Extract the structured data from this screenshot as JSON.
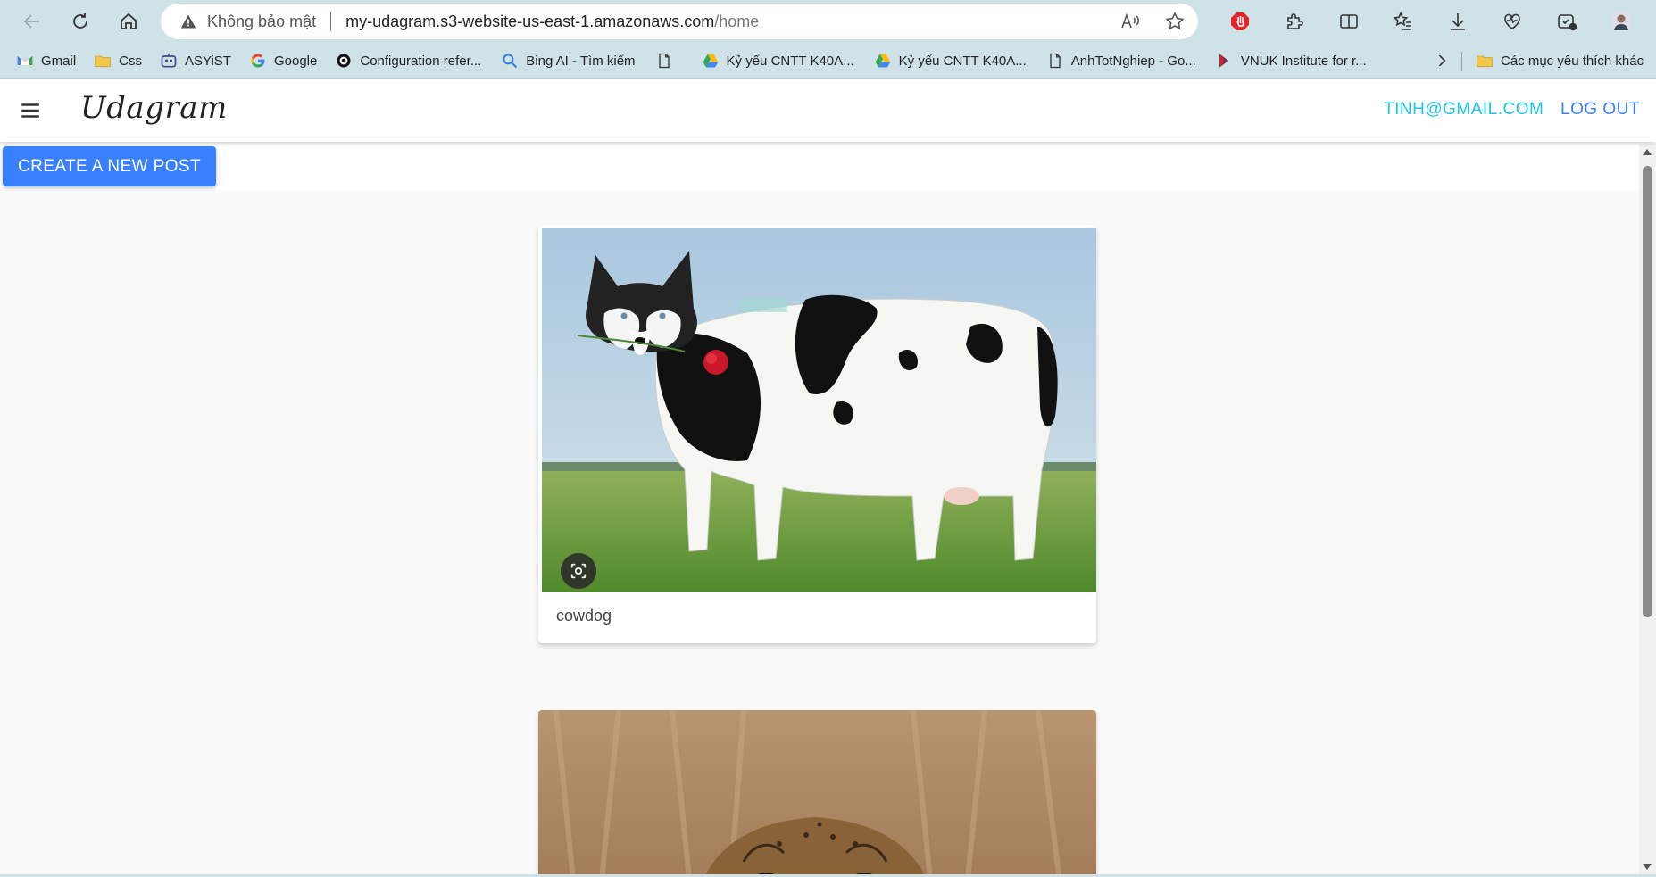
{
  "browser": {
    "security_label": "Không bảo mật",
    "url_host": "my-udagram.s3-website-us-east-1.amazonaws.com",
    "url_path": "/home",
    "bookmarks": [
      {
        "label": "Gmail",
        "icon": "gmail-icon"
      },
      {
        "label": "Css",
        "icon": "folder-icon"
      },
      {
        "label": "ASYiST",
        "icon": "asyist-icon"
      },
      {
        "label": "Google",
        "icon": "google-icon"
      },
      {
        "label": "Configuration refer...",
        "icon": "circle-logo-icon"
      },
      {
        "label": "Bing AI - Tìm kiếm",
        "icon": "search-icon"
      },
      {
        "label": "",
        "icon": "page-icon"
      },
      {
        "label": "Kỷ yếu CNTT K40A...",
        "icon": "google-drive-icon"
      },
      {
        "label": "Kỷ yếu CNTT K40A...",
        "icon": "google-drive-icon"
      },
      {
        "label": "AnhTotNghiep - Go...",
        "icon": "page-icon"
      },
      {
        "label": "VNUK Institute for r...",
        "icon": "vnuk-icon"
      }
    ],
    "other_bookmarks": "Các mục yêu thích khác"
  },
  "app": {
    "brand": "Udagram",
    "user_email": "TINH@GMAIL.COM",
    "logout_label": "LOG OUT",
    "create_post_label": "CREATE A NEW POST"
  },
  "feed": {
    "posts": [
      {
        "caption": "cowdog"
      },
      {
        "caption": ""
      }
    ]
  },
  "colors": {
    "accent": "#3880ff",
    "email_link": "#1bc6e6",
    "chrome": "#cfe2e8"
  }
}
